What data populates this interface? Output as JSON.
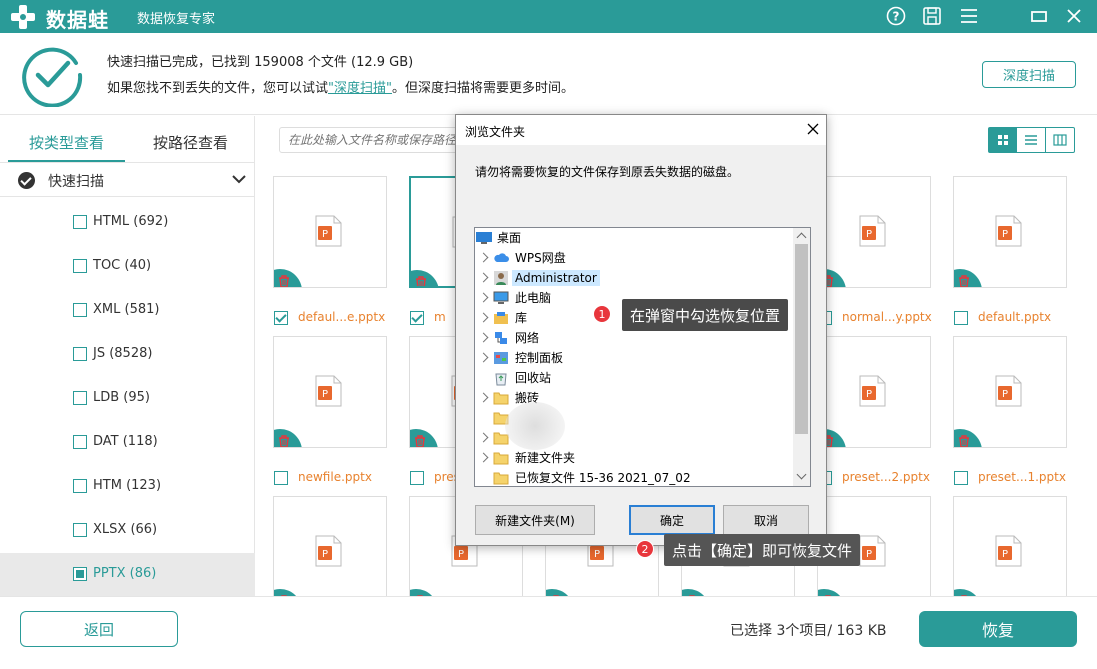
{
  "app": {
    "logo_text": "数据蛙",
    "subtitle": "数据恢复专家",
    "accent": "#2a9b98"
  },
  "titlebar_icons": [
    "help-icon",
    "save-icon",
    "menu-icon",
    "minimize-icon",
    "close-icon"
  ],
  "status": {
    "line1": "快速扫描已完成，已找到 159008 个文件 (12.9 GB)",
    "line2_prefix": "如果您找不到丢失的文件，您可以试试",
    "line2_link": "\"深度扫描\"",
    "line2_suffix": "。但深度扫描将需要更多时间。",
    "deep_scan_button": "深度扫描"
  },
  "sidebar": {
    "tab_by_type": "按类型查看",
    "tab_by_path": "按路径查看",
    "quick_scan": "快速扫描",
    "categories": [
      {
        "label": "HTML (692)",
        "checked": false
      },
      {
        "label": "TOC (40)",
        "checked": false
      },
      {
        "label": "XML (581)",
        "checked": false
      },
      {
        "label": "JS (8528)",
        "checked": false
      },
      {
        "label": "LDB (95)",
        "checked": false
      },
      {
        "label": "DAT (118)",
        "checked": false
      },
      {
        "label": "HTM (123)",
        "checked": false
      },
      {
        "label": "XLSX (66)",
        "checked": false
      },
      {
        "label": "PPTX (86)",
        "checked": true
      }
    ]
  },
  "search": {
    "placeholder": "在此处输入文件名称或保存路径"
  },
  "files": [
    {
      "name": "defaul...e.pptx",
      "checked": true
    },
    {
      "name": "m",
      "checked": true
    },
    {
      "name": "",
      "checked": false
    },
    {
      "name": "",
      "checked": false
    },
    {
      "name": "normal...y.pptx",
      "checked": false
    },
    {
      "name": "default.pptx",
      "checked": false
    },
    {
      "name": "newfile.pptx",
      "checked": false
    },
    {
      "name": "pres",
      "checked": false
    },
    {
      "name": "",
      "checked": false
    },
    {
      "name": "",
      "checked": false
    },
    {
      "name": "preset...2.pptx",
      "checked": false
    },
    {
      "name": "preset...1.pptx",
      "checked": false
    }
  ],
  "footer": {
    "back": "返回",
    "selected": "已选择 3个项目/ 163 KB",
    "recover": "恢复"
  },
  "dialog": {
    "title": "浏览文件夹",
    "message": "请勿将需要恢复的文件保存到原丢失数据的磁盘。",
    "tree": [
      {
        "label": "桌面",
        "icon": "desktop-icon",
        "expandable": false,
        "indent": 0
      },
      {
        "label": "WPS网盘",
        "icon": "cloud-icon",
        "expandable": true,
        "indent": 1
      },
      {
        "label": "Administrator",
        "icon": "user-icon",
        "expandable": true,
        "indent": 1,
        "highlighted": true
      },
      {
        "label": "此电脑",
        "icon": "computer-icon",
        "expandable": true,
        "indent": 1
      },
      {
        "label": "库",
        "icon": "library-icon",
        "expandable": true,
        "indent": 1
      },
      {
        "label": "网络",
        "icon": "network-icon",
        "expandable": true,
        "indent": 1
      },
      {
        "label": "控制面板",
        "icon": "control-panel-icon",
        "expandable": true,
        "indent": 1
      },
      {
        "label": "回收站",
        "icon": "recycle-bin-icon",
        "expandable": false,
        "indent": 1
      },
      {
        "label": "搬砖",
        "icon": "folder-icon",
        "expandable": true,
        "indent": 1
      },
      {
        "label": "",
        "icon": "folder-icon",
        "expandable": false,
        "indent": 1
      },
      {
        "label": "",
        "icon": "folder-icon",
        "expandable": true,
        "indent": 1
      },
      {
        "label": "新建文件夹",
        "icon": "folder-icon",
        "expandable": true,
        "indent": 1
      },
      {
        "label": "已恢复文件 15-36 2021_07_02",
        "icon": "folder-icon",
        "expandable": false,
        "indent": 1
      }
    ],
    "new_folder": "新建文件夹(M)",
    "ok": "确定",
    "cancel": "取消"
  },
  "callouts": [
    {
      "badge": "1",
      "text": "在弹窗中勾选恢复位置"
    },
    {
      "badge": "2",
      "text": "点击【确定】即可恢复文件"
    }
  ]
}
